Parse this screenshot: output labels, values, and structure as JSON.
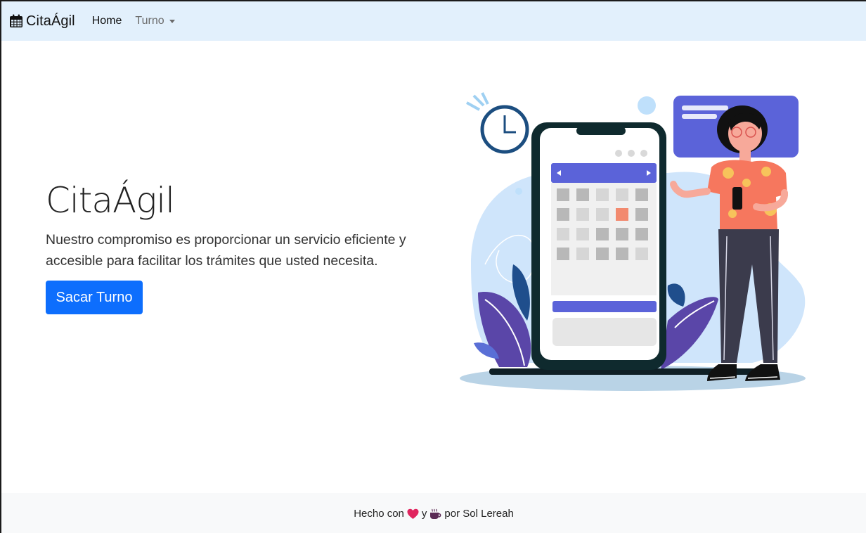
{
  "navbar": {
    "brand_icon": "calendar-icon",
    "brand": "CitaÁgil",
    "links": [
      {
        "label": "Home"
      },
      {
        "label": "Turno"
      }
    ]
  },
  "hero": {
    "title": "CitaÁgil",
    "description": "Nuestro compromiso es proporcionar un servicio eficiente y accesible para facilitar los trámites que usted necesita.",
    "button_label": "Sacar Turno",
    "illustration": "woman-with-phone-calendar-illustration"
  },
  "footer": {
    "prefix": "Hecho con",
    "heart_icon": "heart-icon",
    "conjunction": "y",
    "coffee_icon": "coffee-icon",
    "suffix": "por Sol Lereah"
  },
  "colors": {
    "navbar_bg": "#e2f0fc",
    "primary": "#0d6efd",
    "heart": "#e0245e",
    "coffee": "#5a2a55",
    "footer_bg": "#f8f9fa"
  }
}
